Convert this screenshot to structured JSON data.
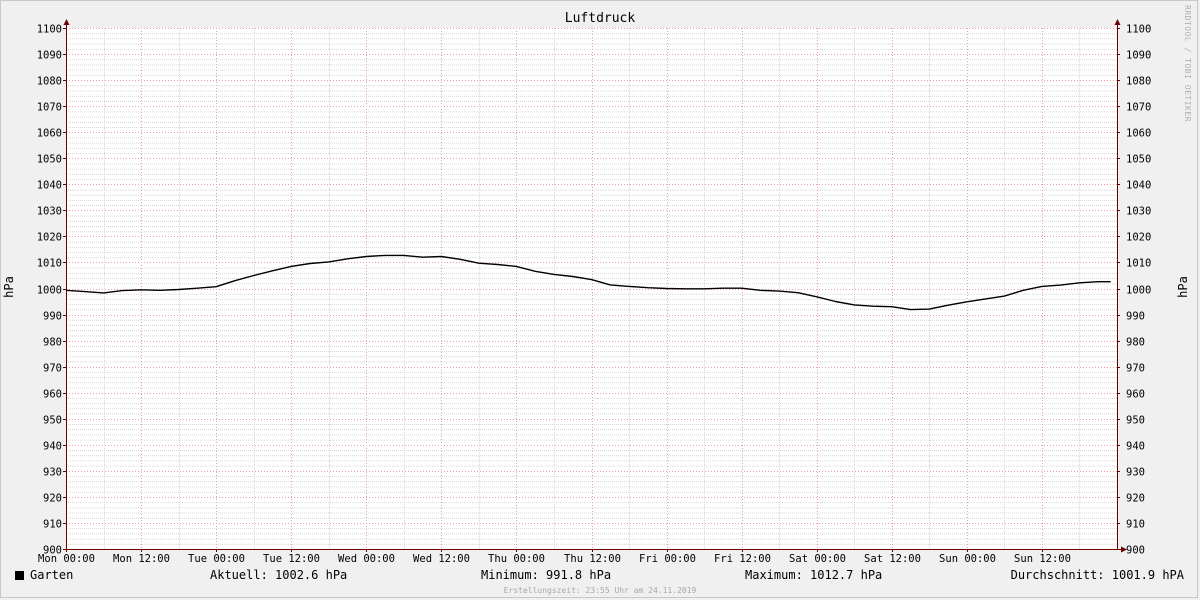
{
  "chart_data": {
    "type": "line",
    "title": "Luftdruck",
    "ylabel": "hPa",
    "ylim": [
      900,
      1100
    ],
    "yticks": [
      900,
      910,
      920,
      930,
      940,
      950,
      960,
      970,
      980,
      990,
      1000,
      1010,
      1020,
      1030,
      1040,
      1050,
      1060,
      1070,
      1080,
      1090,
      1100
    ],
    "x_range": [
      "Mon 00:00",
      "Sun 23:55"
    ],
    "x_ticks": [
      "Mon 00:00",
      "Mon 12:00",
      "Tue 00:00",
      "Tue 12:00",
      "Wed 00:00",
      "Wed 12:00",
      "Thu 00:00",
      "Thu 12:00",
      "Fri 00:00",
      "Fri 12:00",
      "Sat 00:00",
      "Sat 12:00",
      "Sun 00:00",
      "Sun 12:00"
    ],
    "grid": true,
    "series": [
      {
        "name": "Garten",
        "color": "#000000",
        "points": [
          [
            "Mon 00:00",
            999.3
          ],
          [
            "Mon 03:00",
            998.8
          ],
          [
            "Mon 06:00",
            998.3
          ],
          [
            "Mon 09:00",
            999.2
          ],
          [
            "Mon 12:00",
            999.5
          ],
          [
            "Mon 15:00",
            999.3
          ],
          [
            "Mon 18:00",
            999.6
          ],
          [
            "Mon 21:00",
            1000.1
          ],
          [
            "Tue 00:00",
            1000.7
          ],
          [
            "Tue 03:00",
            1003.0
          ],
          [
            "Tue 06:00",
            1005.0
          ],
          [
            "Tue 09:00",
            1006.8
          ],
          [
            "Tue 12:00",
            1008.5
          ],
          [
            "Tue 15:00",
            1009.6
          ],
          [
            "Tue 18:00",
            1010.2
          ],
          [
            "Tue 21:00",
            1011.4
          ],
          [
            "Wed 00:00",
            1012.3
          ],
          [
            "Wed 03:00",
            1012.7
          ],
          [
            "Wed 06:00",
            1012.7
          ],
          [
            "Wed 09:00",
            1012.0
          ],
          [
            "Wed 12:00",
            1012.3
          ],
          [
            "Wed 15:00",
            1011.2
          ],
          [
            "Wed 18:00",
            1009.7
          ],
          [
            "Wed 21:00",
            1009.2
          ],
          [
            "Thu 00:00",
            1008.5
          ],
          [
            "Thu 03:00",
            1006.6
          ],
          [
            "Thu 06:00",
            1005.4
          ],
          [
            "Thu 09:00",
            1004.6
          ],
          [
            "Thu 12:00",
            1003.4
          ],
          [
            "Thu 15:00",
            1001.4
          ],
          [
            "Thu 18:00",
            1000.8
          ],
          [
            "Thu 21:00",
            1000.3
          ],
          [
            "Fri 00:00",
            1000.0
          ],
          [
            "Fri 03:00",
            999.9
          ],
          [
            "Fri 06:00",
            999.9
          ],
          [
            "Fri 09:00",
            1000.1
          ],
          [
            "Fri 12:00",
            1000.1
          ],
          [
            "Fri 15:00",
            999.3
          ],
          [
            "Fri 18:00",
            999.0
          ],
          [
            "Fri 21:00",
            998.4
          ],
          [
            "Sat 00:00",
            996.8
          ],
          [
            "Sat 03:00",
            995.0
          ],
          [
            "Sat 06:00",
            993.7
          ],
          [
            "Sat 09:00",
            993.2
          ],
          [
            "Sat 12:00",
            993.0
          ],
          [
            "Sat 15:00",
            991.9
          ],
          [
            "Sat 18:00",
            992.1
          ],
          [
            "Sat 21:00",
            993.6
          ],
          [
            "Sun 00:00",
            994.9
          ],
          [
            "Sun 03:00",
            996.0
          ],
          [
            "Sun 06:00",
            997.1
          ],
          [
            "Sun 09:00",
            999.3
          ],
          [
            "Sun 12:00",
            1000.8
          ],
          [
            "Sun 15:00",
            1001.3
          ],
          [
            "Sun 18:00",
            1002.2
          ],
          [
            "Sun 21:00",
            1002.6
          ]
        ]
      }
    ]
  },
  "legend": {
    "series_name": "Garten",
    "aktuell": "Aktuell: 1002.6 hPa",
    "minimum": "Minimum: 991.8 hPa",
    "maximum": "Maximum: 1012.7 hPa",
    "durchschnitt": "Durchschnitt: 1001.9 hPA"
  },
  "watermark": "RRDTOOL / TOBI OETIKER",
  "footer": "Erstellungszeit: 23:55 Uhr am 24.11.2019",
  "colors": {
    "background": "#f0f0f0",
    "plot_background": "#ffffff",
    "minor_grid": "#d6d6d6",
    "major_grid": "#e8a0a0",
    "axis": "#6a0000",
    "line": "#000000"
  }
}
